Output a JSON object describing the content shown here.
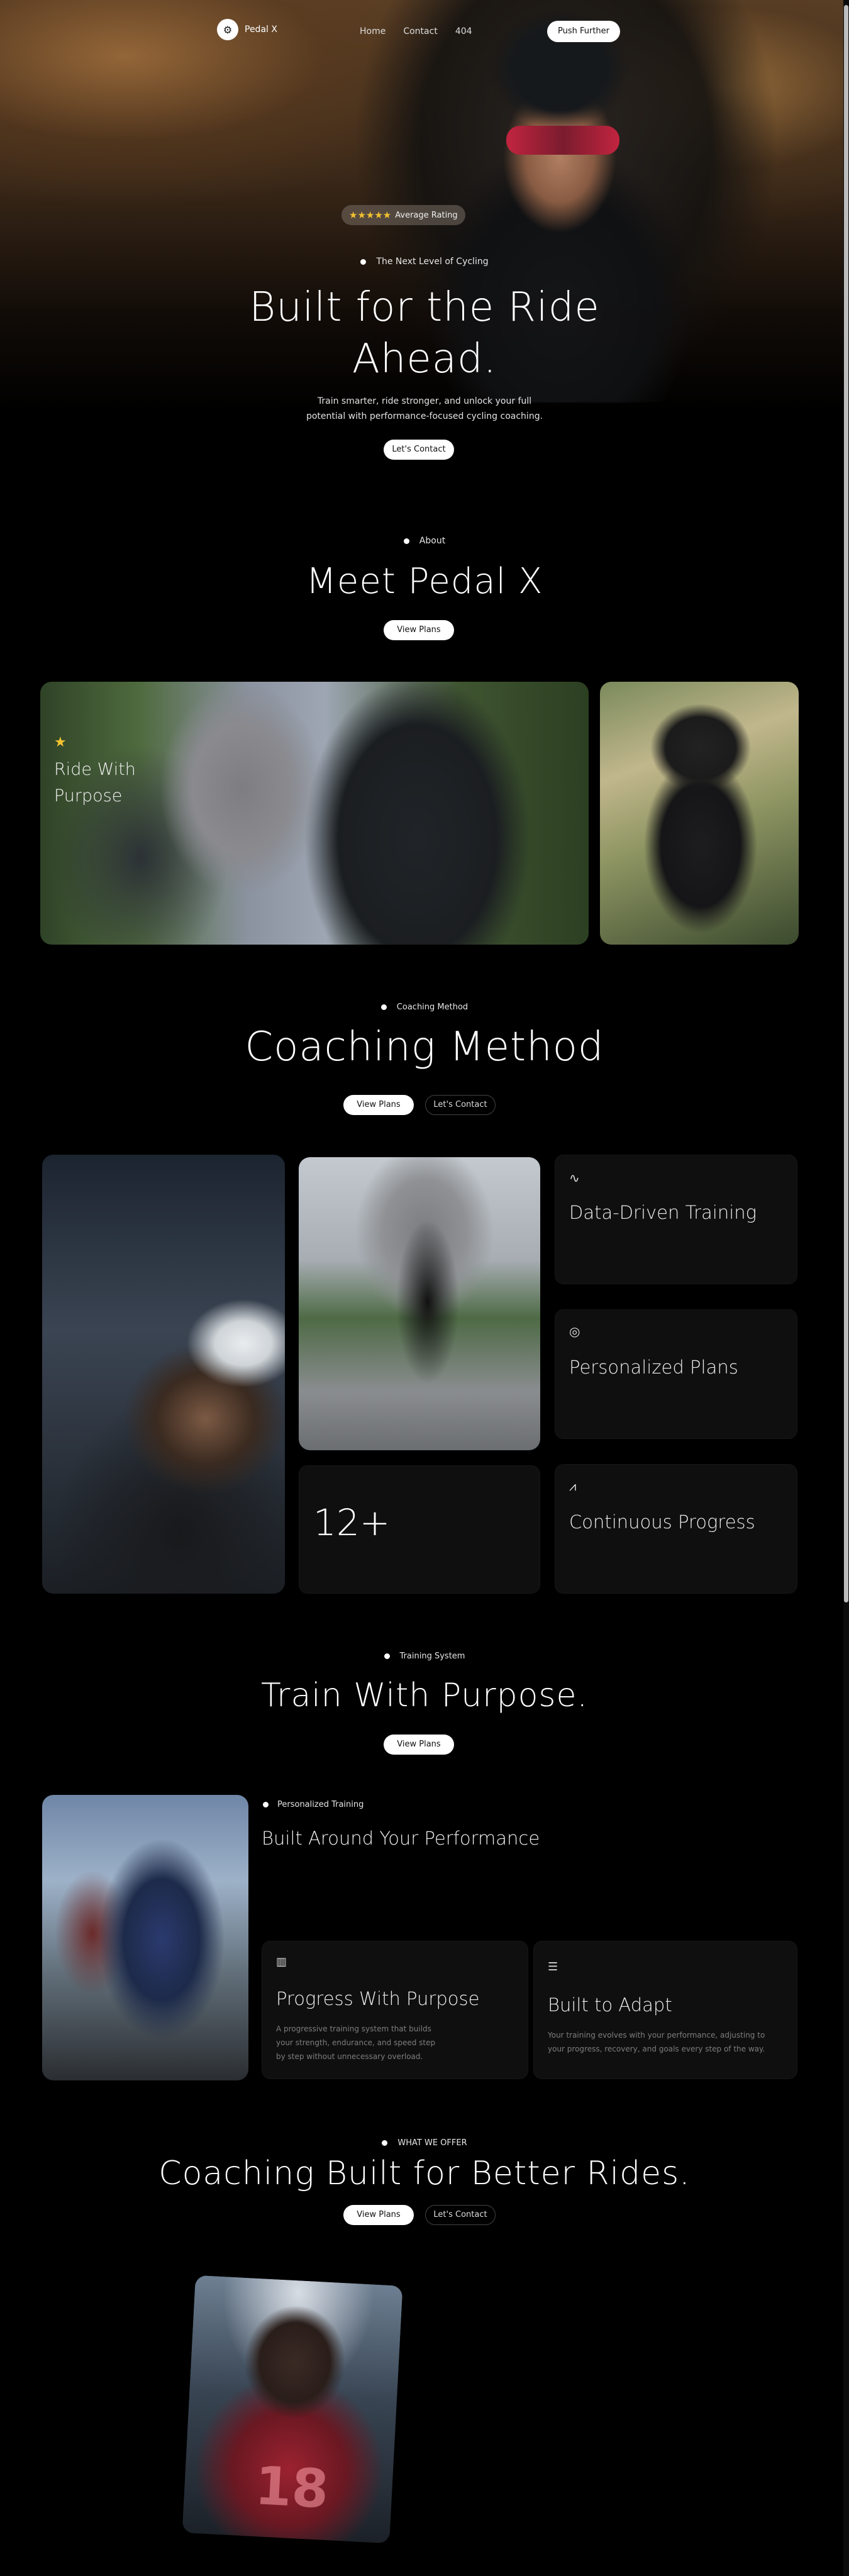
{
  "nav": {
    "logo_icon": "bike-icon",
    "logo_glyph": "⚙",
    "brand": "Pedal X",
    "links": [
      "Home",
      "Contact",
      "404"
    ],
    "cta": "Push Further"
  },
  "hero": {
    "stars": "★★★★★",
    "rating": "Average Rating",
    "eyebrow": "The Next Level of Cycling",
    "title_line1": "Built for the Ride",
    "title_line2": "Ahead.",
    "subtitle_line1": "Train smarter, ride stronger, and unlock your full",
    "subtitle_line2": "potential with performance-focused cycling coaching.",
    "cta": "Let's Contact"
  },
  "about": {
    "eyebrow": "About",
    "title": "Meet Pedal X",
    "cta": "View Plans",
    "card_star": "★",
    "card_label_line1": "Ride With",
    "card_label_line2": "Purpose"
  },
  "coaching": {
    "eyebrow": "Coaching Method",
    "title": "Coaching Method",
    "cta_primary": "View Plans",
    "cta_secondary": "Let's Contact",
    "stat": "12+",
    "features": [
      {
        "icon": "activity-icon",
        "glyph": "∿",
        "title": "Data-Driven Training"
      },
      {
        "icon": "target-icon",
        "glyph": "◎",
        "title": "Personalized Plans"
      },
      {
        "icon": "chart-icon",
        "glyph": "⩘",
        "title": "Continuous Progress"
      }
    ]
  },
  "training": {
    "eyebrow": "Training System",
    "title": "Train With Purpose.",
    "cta": "View Plans",
    "sub_eyebrow": "Personalized Training",
    "sub_title": "Built Around Your Performance",
    "card1": {
      "icon": "bar-chart-icon",
      "glyph": "▥",
      "title": "Progress With Purpose",
      "text_line1": "A progressive training system that builds",
      "text_line2": "your strength, endurance, and speed step",
      "text_line3": "by step without unnecessary overload."
    },
    "card2": {
      "icon": "sliders-icon",
      "glyph": "☰",
      "title": "Built to Adapt",
      "text_line1": "Your training evolves with your performance, adjusting to",
      "text_line2": "your progress, recovery, and goals every step of the way."
    }
  },
  "offer": {
    "eyebrow": "WHAT WE OFFER",
    "title": "Coaching Built for Better Rides.",
    "cta_primary": "View Plans",
    "cta_secondary": "Let's Contact",
    "jersey_number": "18"
  },
  "colors": {
    "star": "#f2c230",
    "background": "#000000",
    "tile": "#0f0f10"
  }
}
